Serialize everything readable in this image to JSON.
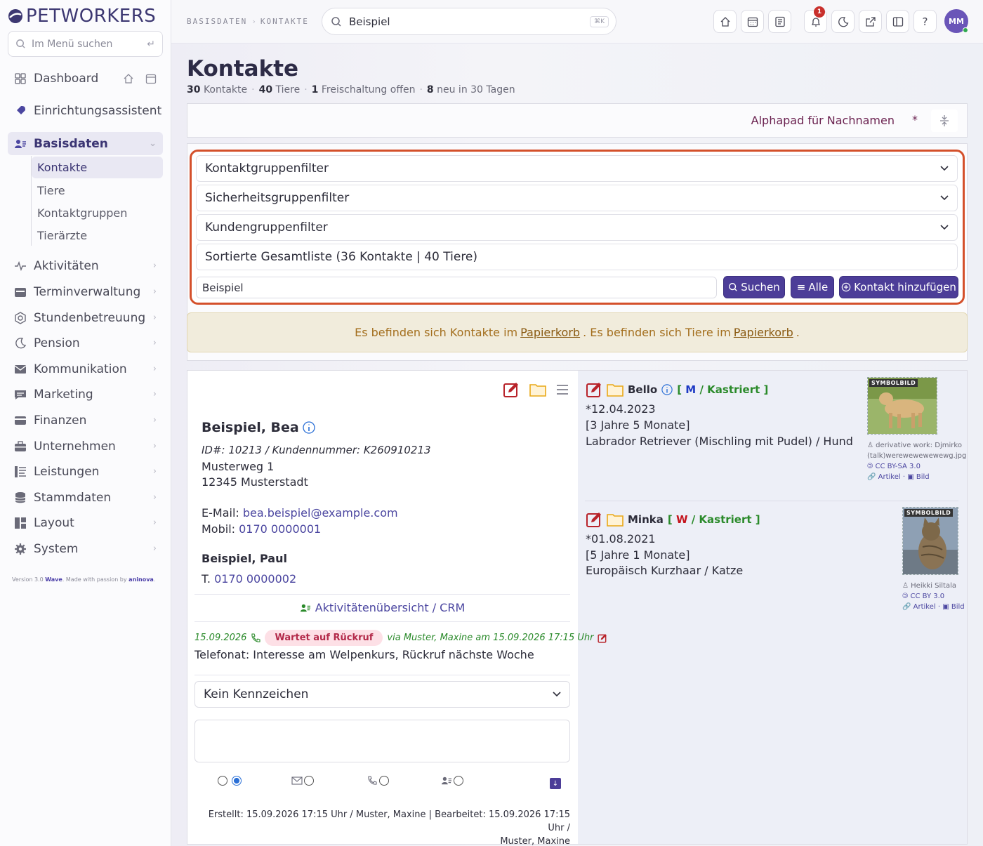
{
  "brand": {
    "logo_text": "PETWORKERS"
  },
  "sidebar": {
    "search_placeholder": "Im Menü suchen",
    "items": [
      {
        "label": "Dashboard",
        "icon": "grid-icon"
      },
      {
        "label": "Einrichtungsassistent",
        "icon": "rocket-icon"
      },
      {
        "label": "Basisdaten",
        "icon": "contacts-icon"
      },
      {
        "label": "Aktivitäten",
        "icon": "activity-icon"
      },
      {
        "label": "Terminverwaltung",
        "icon": "calendar-icon"
      },
      {
        "label": "Stundenbetreuung",
        "icon": "clock-icon"
      },
      {
        "label": "Pension",
        "icon": "moon-icon"
      },
      {
        "label": "Kommunikation",
        "icon": "mail-icon"
      },
      {
        "label": "Marketing",
        "icon": "chat-icon"
      },
      {
        "label": "Finanzen",
        "icon": "card-icon"
      },
      {
        "label": "Unternehmen",
        "icon": "briefcase-icon"
      },
      {
        "label": "Leistungen",
        "icon": "list-icon"
      },
      {
        "label": "Stammdaten",
        "icon": "database-icon"
      },
      {
        "label": "Layout",
        "icon": "layout-icon"
      },
      {
        "label": "System",
        "icon": "gear-icon"
      }
    ],
    "subitems": [
      "Kontakte",
      "Tiere",
      "Kontaktgruppen",
      "Tierärzte"
    ],
    "version": {
      "prefix": "Version 3.0",
      "theme": "Wave",
      "made": ". Made with passion by",
      "company": "aninova",
      "suffix": "."
    }
  },
  "topbar": {
    "crumb1": "BASISDATEN",
    "crumb2": "KONTAKTE",
    "search_value": "Beispiel",
    "search_kbd": "⌘K",
    "notification_count": "1",
    "help": "?",
    "avatar_initials": "MM"
  },
  "page": {
    "title": "Kontakte",
    "stats": {
      "contacts_num": "30",
      "contacts_lbl": "Kontakte",
      "animals_num": "40",
      "animals_lbl": "Tiere",
      "release_num": "1",
      "release_lbl": "Freischaltung offen",
      "new_num": "8",
      "new_lbl": "neu in 30 Tagen"
    }
  },
  "alphapad": {
    "label": "Alphapad für Nachnamen",
    "star": "*"
  },
  "filters": {
    "group": "Kontaktgruppenfilter",
    "security": "Sicherheitsgruppenfilter",
    "customer": "Kundengruppenfilter",
    "full_list": "Sortierte Gesamtliste (36 Kontakte | 40 Tiere)",
    "input_value": "Beispiel",
    "search_btn": "Suchen",
    "all_btn": "Alle",
    "add_btn": "Kontakt hinzufügen"
  },
  "notice": {
    "part1": "Es befinden sich Kontakte im",
    "link1": "Papierkorb",
    "part2": ".  Es befinden sich Tiere im",
    "link2": "Papierkorb",
    "part3": "."
  },
  "contact": {
    "name": "Beispiel, Bea",
    "id_line": "ID#: 10213 / Kundennummer: K260910213",
    "street": "Musterweg 1",
    "city": "12345 Musterstadt",
    "email_label": "E-Mail:",
    "email": "bea.beispiel@example.com",
    "mobile_label": "Mobil:",
    "mobile": "0170 0000001",
    "second_name": "Beispiel, Paul",
    "phone_label": "T.",
    "phone": "0170 0000002",
    "crm_link": "Aktivitätenübersicht / CRM",
    "activity": {
      "date": "15.09.2026",
      "status": "Wartet auf Rückruf",
      "by": "via Muster, Maxine am 15.09.2026 17:15 Uhr",
      "text": "Telefonat: Interesse am Welpenkurs, Rückruf nächste Woche"
    },
    "marker_select": "Kein Kennzeichen",
    "meta_line1": "Erstellt: 15.09.2026 17:15 Uhr / Muster, Maxine | Bearbeitet: 15.09.2026 17:15 Uhr /",
    "meta_line2": "Muster, Maxine"
  },
  "animals": [
    {
      "name": "Bello",
      "sex": "M",
      "status": "Kastriert",
      "birth": "*12.04.2023",
      "age": "[3 Jahre 5 Monate]",
      "breed": "Labrador Retriever (Mischling mit Pudel) / Hund",
      "symbol": "SYMBOLBILD",
      "credit_author": "derivative work: Djmirko (talk)werewewewewewg.jpg",
      "credit_license": "CC BY-SA 3.0",
      "credit_links": "Artikel · ",
      "credit_image": "Bild"
    },
    {
      "name": "Minka",
      "sex": "W",
      "status": "Kastriert",
      "birth": "*01.08.2021",
      "age": "[5 Jahre 1 Monate]",
      "breed": "Europäisch Kurzhaar / Katze",
      "symbol": "SYMBOLBILD",
      "credit_author": "Heikki Siltala",
      "credit_license": "CC BY 3.0",
      "credit_links": "Artikel · ",
      "credit_image": "Bild"
    }
  ],
  "colors": {
    "primary": "#4c3d98",
    "highlight_border": "#d4502b",
    "notice_bg": "#f1ecdc",
    "status_pill": "#fde0e6"
  }
}
